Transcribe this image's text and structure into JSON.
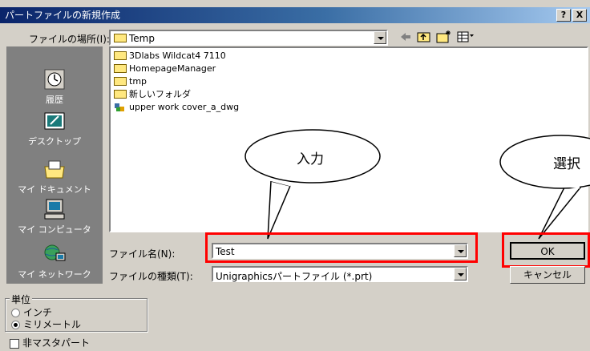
{
  "dialog": {
    "title": "パートファイルの新規作成",
    "help_button": "?",
    "close_button": "X"
  },
  "location": {
    "label": "ファイルの場所(I):",
    "value": "Temp"
  },
  "places": [
    {
      "label": "履歴",
      "icon": "history-icon"
    },
    {
      "label": "デスクトップ",
      "icon": "desktop-icon"
    },
    {
      "label": "マイ ドキュメント",
      "icon": "my-documents-icon"
    },
    {
      "label": "マイ コンピュータ",
      "icon": "my-computer-icon"
    },
    {
      "label": "マイ ネットワーク",
      "icon": "my-network-icon"
    }
  ],
  "files": [
    {
      "name": "3Dlabs Wildcat4 7110",
      "type": "folder"
    },
    {
      "name": "HomepageManager",
      "type": "folder"
    },
    {
      "name": "tmp",
      "type": "folder"
    },
    {
      "name": "新しいフォルダ",
      "type": "folder"
    },
    {
      "name": "upper work cover_a_dwg",
      "type": "file"
    }
  ],
  "filename": {
    "label": "ファイル名(N):",
    "value": "Test"
  },
  "filetype": {
    "label": "ファイルの種類(T):",
    "value": "Unigraphicsパートファイル (*.prt)"
  },
  "buttons": {
    "ok": "OK",
    "cancel": "キャンセル"
  },
  "units": {
    "label": "単位",
    "inch": "インチ",
    "mm": "ミリメートル",
    "selected": "ミリメートル"
  },
  "nonmaster": {
    "label": "非マスタパート",
    "checked": false
  },
  "annotations": {
    "input": "入力",
    "select": "選択"
  },
  "colors": {
    "highlight": "#ff0000",
    "title_start": "#0a246a",
    "title_end": "#a6caf0"
  }
}
